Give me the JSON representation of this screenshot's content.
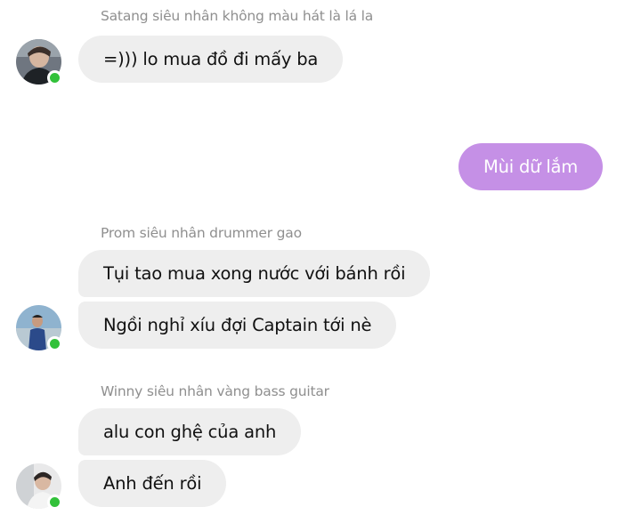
{
  "messages": {
    "group1": {
      "sender": "Satang siêu nhân không màu hát là lá la",
      "msg1": "=))) lo mua đồ đi mấy ba"
    },
    "own": {
      "msg1": "Mùi dữ lắm"
    },
    "group2": {
      "sender": "Prom siêu nhân drummer gao",
      "msg1": "Tụi tao mua xong nước với bánh rồi",
      "msg2": "Ngồi nghỉ xíu đợi Captain tới nè"
    },
    "group3": {
      "sender": "Winny siêu nhân vàng bass guitar",
      "msg1": "alu con ghệ của anh",
      "msg2": "Anh đến rồi"
    }
  },
  "colors": {
    "incoming_bubble": "#eeeeee",
    "outgoing_bubble": "#c590e6",
    "online_dot": "#32c13a",
    "sender_name": "#8f8f8f"
  }
}
